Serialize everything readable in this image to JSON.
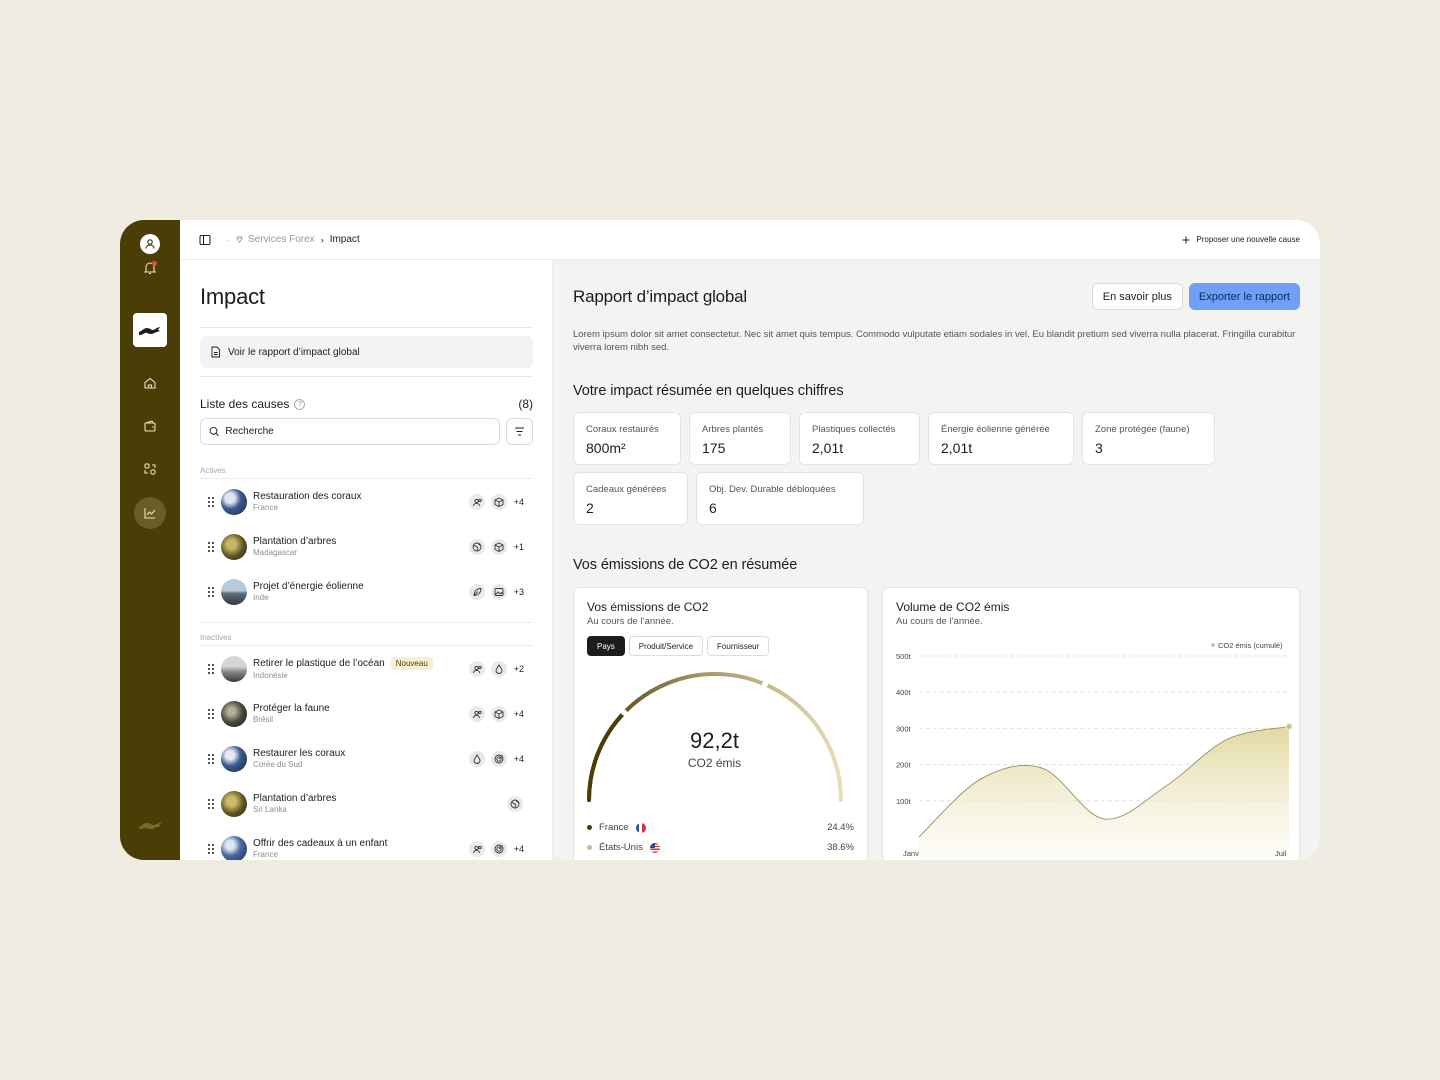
{
  "breadcrumb": {
    "org": "Services Forex",
    "current": "Impact"
  },
  "topbar": {
    "propose_label": "Proposer une nouvelle cause"
  },
  "left": {
    "title": "Impact",
    "report_button": "Voir le rapport d’impact global",
    "list_title": "Liste des causes",
    "list_count": "(8)",
    "search_placeholder": "Recherche",
    "active_label": "Actives",
    "inactive_label": "Inactives",
    "active": [
      {
        "name": "Restauration des coraux",
        "location": "France",
        "more": "+4",
        "icons": [
          "people-icon",
          "cube-icon"
        ]
      },
      {
        "name": "Plantation d’arbres",
        "location": "Madagascar",
        "more": "+1",
        "icons": [
          "globe-icon",
          "cube-icon"
        ]
      },
      {
        "name": "Projet d’énergie éolienne",
        "location": "Inde",
        "more": "+3",
        "icons": [
          "leaf-icon",
          "image-icon"
        ]
      }
    ],
    "inactive": [
      {
        "name": "Retirer le plastique de l’océan",
        "badge": "Nouveau",
        "location": "Indonésie",
        "more": "+2",
        "icons": [
          "people-icon",
          "drop-icon"
        ]
      },
      {
        "name": "Protéger la faune",
        "location": "Brésil",
        "more": "+4",
        "icons": [
          "people-icon",
          "cube-icon"
        ]
      },
      {
        "name": "Restaurer les coraux",
        "location": "Corée du Sud",
        "more": "+4",
        "icons": [
          "drop-icon",
          "target-icon"
        ]
      },
      {
        "name": "Plantation d’arbres",
        "location": "Sri Lanka",
        "more": "",
        "icons": [
          "globe-icon"
        ]
      },
      {
        "name": "Offrir des cadeaux à un enfant",
        "location": "France",
        "more": "+4",
        "icons": [
          "people-icon",
          "target-icon"
        ]
      }
    ]
  },
  "right": {
    "title": "Rapport d’impact global",
    "learn_more": "En savoir plus",
    "export": "Exporter le rapport",
    "description": "Lorem ipsum dolor sit amet consectetur. Nec sit amet quis tempus. Commodo vulputate etiam sodales in vel. Eu blandit pretium sed viverra nulla placerat. Fringilla curabitur viverra lorem nibh sed.",
    "summary_title": "Votre impact résumée en quelques chiffres",
    "stats": [
      {
        "label": "Coraux restaurés",
        "value": "800m²"
      },
      {
        "label": "Arbres plantés",
        "value": "175"
      },
      {
        "label": "Plastiques collectés",
        "value": "2,01t"
      },
      {
        "label": "Énergie éolienne générée",
        "value": "2,01t"
      },
      {
        "label": "Zone protégée (faune)",
        "value": "3"
      },
      {
        "label": "Cadeaux générées",
        "value": "2"
      },
      {
        "label": "Obj. Dev. Durable débloquées",
        "value": "6"
      }
    ],
    "emissions_title": "Vos émissions de CO2 en résumée",
    "gauge_card": {
      "title": "Vos émissions de CO2",
      "subtitle": "Au cours de l’année.",
      "tabs": [
        "Pays",
        "Produit/Service",
        "Fournisseur"
      ],
      "active_tab": "Pays",
      "value": "92,2t",
      "value_label": "CO2 émis",
      "legend": [
        {
          "name": "France",
          "pct": "24.4%",
          "color": "#4a3d06"
        },
        {
          "name": "États-Unis",
          "pct": "38.6%",
          "color": "#c7b99a"
        }
      ]
    },
    "area_card": {
      "title": "Volume de CO2 émis",
      "subtitle": "Au cours de l’année.",
      "legend": "CO2 émis (cumulé)"
    }
  },
  "chart_data": [
    {
      "type": "gauge",
      "title": "Vos émissions de CO2",
      "total": "92,2t",
      "segments": [
        {
          "name": "France",
          "pct": 24.4
        },
        {
          "name": "États-Unis",
          "pct": 38.6
        }
      ]
    },
    {
      "type": "area",
      "title": "Volume de CO2 émis",
      "series": [
        {
          "name": "CO2 émis (cumulé)",
          "x": [
            "Janv",
            "",
            "",
            "",
            "",
            "",
            "Juil"
          ],
          "values": [
            0,
            160,
            190,
            50,
            140,
            270,
            305
          ]
        }
      ],
      "y_ticks": [
        "100t",
        "200t",
        "300t",
        "400t",
        "500t"
      ],
      "x_ticks": [
        "Janv",
        "Juil"
      ],
      "ylim": [
        0,
        500
      ]
    }
  ]
}
